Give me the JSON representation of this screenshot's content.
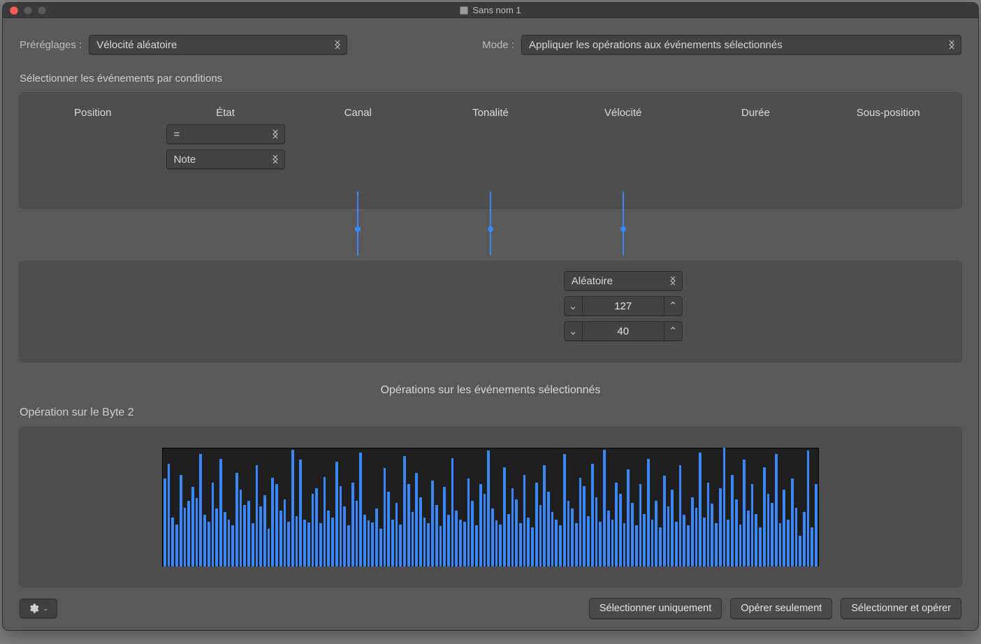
{
  "window": {
    "title": "Sans nom 1"
  },
  "top": {
    "presets_label": "Préréglages :",
    "preset_value": "Vélocité aléatoire",
    "mode_label": "Mode :",
    "mode_value": "Appliquer les opérations aux événements sélectionnés"
  },
  "conditions": {
    "section_label": "Sélectionner les événements par conditions",
    "headers": [
      "Position",
      "État",
      "Canal",
      "Tonalité",
      "Vélocité",
      "Durée",
      "Sous-position"
    ],
    "etat_op": "=",
    "etat_type": "Note"
  },
  "operations": {
    "caption": "Opérations sur les événements sélectionnés",
    "velocity_mode": "Aléatoire",
    "velocity_high": "127",
    "velocity_low": "40"
  },
  "byte2": {
    "label": "Opération sur le Byte 2",
    "bars": [
      94,
      110,
      52,
      45,
      98,
      63,
      70,
      85,
      73,
      120,
      55,
      48,
      90,
      62,
      115,
      58,
      50,
      44,
      100,
      82,
      66,
      70,
      46,
      108,
      64,
      76,
      40,
      95,
      88,
      60,
      72,
      48,
      125,
      54,
      114,
      50,
      47,
      78,
      84,
      46,
      96,
      60,
      52,
      112,
      86,
      64,
      44,
      90,
      70,
      122,
      55,
      49,
      47,
      62,
      40,
      105,
      80,
      50,
      68,
      45,
      118,
      88,
      58,
      100,
      74,
      52,
      46,
      92,
      66,
      43,
      85,
      55,
      116,
      60,
      50,
      48,
      94,
      70,
      44,
      88,
      78,
      124,
      62,
      49,
      45,
      106,
      56,
      84,
      72,
      46,
      98,
      52,
      42,
      90,
      66,
      108,
      80,
      58,
      50,
      44,
      120,
      70,
      62,
      46,
      95,
      86,
      54,
      110,
      74,
      48,
      125,
      60,
      50,
      90,
      78,
      46,
      104,
      68,
      44,
      88,
      56,
      115,
      50,
      70,
      42,
      97,
      64,
      82,
      48,
      108,
      55,
      44,
      74,
      63,
      122,
      52,
      90,
      67,
      46,
      84,
      127,
      50,
      98,
      72,
      45,
      114,
      60,
      88,
      56,
      42,
      106,
      78,
      68,
      120,
      46,
      82,
      50,
      94,
      63,
      33,
      58,
      124,
      42,
      88
    ]
  },
  "footer": {
    "select_only": "Sélectionner uniquement",
    "operate_only": "Opérer seulement",
    "select_and_operate": "Sélectionner et opérer"
  },
  "icons": {
    "chevron_up": "⌃",
    "chevron_down": "⌄"
  }
}
